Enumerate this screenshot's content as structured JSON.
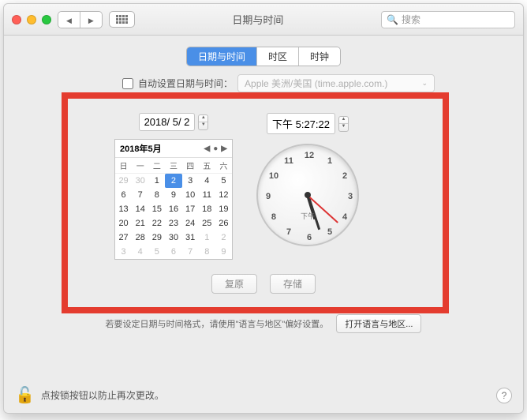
{
  "window_title": "日期与时间",
  "search_placeholder": "搜索",
  "tabs": [
    "日期与时间",
    "时区",
    "时钟"
  ],
  "active_tab_index": 0,
  "auto_set": {
    "label": "自动设置日期与时间：",
    "server": "Apple 美洲/美国 (time.apple.com.)",
    "checked": false
  },
  "date_field": "2018/ 5/ 2",
  "time_field": "下午  5:27:22",
  "calendar": {
    "title": "2018年5月",
    "dow": [
      "日",
      "一",
      "二",
      "三",
      "四",
      "五",
      "六"
    ],
    "leading": [
      29,
      30
    ],
    "days": [
      1,
      2,
      3,
      4,
      5,
      6,
      7,
      8,
      9,
      10,
      11,
      12,
      13,
      14,
      15,
      16,
      17,
      18,
      19,
      20,
      21,
      22,
      23,
      24,
      25,
      26,
      27,
      28,
      29,
      30,
      31
    ],
    "trailing": [
      1,
      2,
      3,
      4,
      5,
      6,
      7,
      8,
      9
    ],
    "selected": 2
  },
  "clock": {
    "numbers": [
      "12",
      "1",
      "2",
      "3",
      "4",
      "5",
      "6",
      "7",
      "8",
      "9",
      "10",
      "11"
    ],
    "ampm_label": "下午"
  },
  "buttons": {
    "revert": "复原",
    "save": "存储"
  },
  "hint": "若要设定日期与时间格式，请使用\"语言与地区\"偏好设置。",
  "open_lang_region": "打开语言与地区...",
  "lock_text": "点按锁按钮以防止再次更改。"
}
